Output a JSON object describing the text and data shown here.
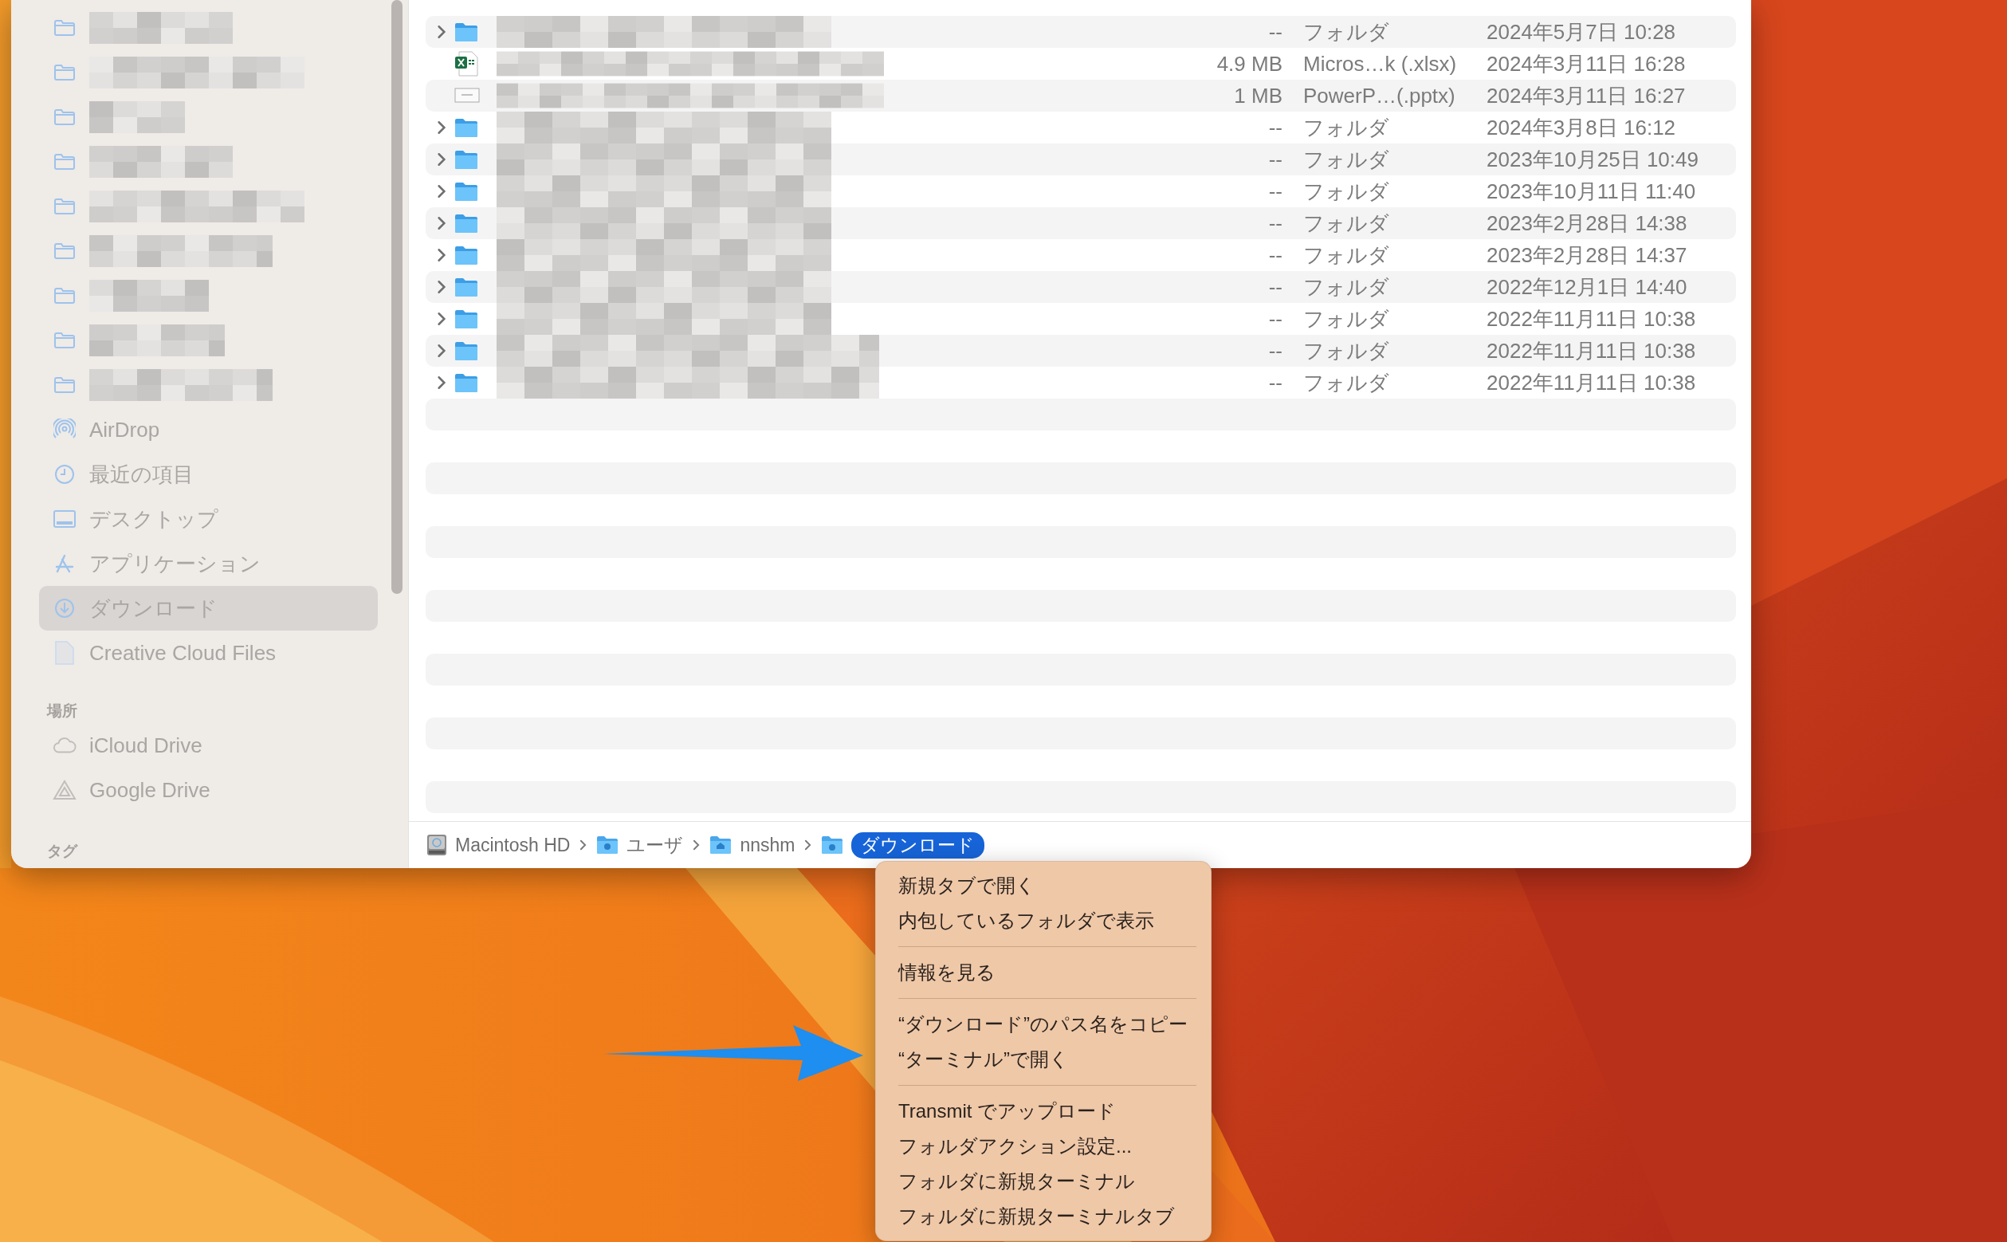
{
  "sidebar": {
    "favorites": [
      {
        "kind": "folder",
        "selected": false
      },
      {
        "kind": "folder",
        "selected": false
      },
      {
        "kind": "folder",
        "selected": false
      },
      {
        "kind": "folder",
        "selected": false
      },
      {
        "kind": "folder",
        "selected": false
      },
      {
        "kind": "folder",
        "selected": false
      },
      {
        "kind": "folder",
        "selected": false
      },
      {
        "kind": "folder",
        "selected": false
      },
      {
        "kind": "folder",
        "selected": false
      },
      {
        "kind": "airdrop",
        "label": "AirDrop",
        "selected": false
      },
      {
        "kind": "clock",
        "label": "最近の項目",
        "selected": false
      },
      {
        "kind": "desktop",
        "label": "デスクトップ",
        "selected": false
      },
      {
        "kind": "apps",
        "label": "アプリケーション",
        "selected": false
      },
      {
        "kind": "download",
        "label": "ダウンロード",
        "selected": true
      },
      {
        "kind": "document",
        "label": "Creative Cloud Files",
        "selected": false
      }
    ],
    "locations": {
      "title": "場所",
      "items": [
        {
          "kind": "cloud",
          "label": "iCloud Drive",
          "selected": false
        },
        {
          "kind": "drive",
          "label": "Google Drive",
          "selected": false
        }
      ]
    },
    "tags": {
      "title": "タグ"
    }
  },
  "file_list": {
    "rows": [
      {
        "kind": "folder",
        "size": "--",
        "type": "フォルダ",
        "modified": "2024年5月7日 10:28"
      },
      {
        "kind": "xlsx",
        "size": "4.9 MB",
        "type": "Micros…k (.xlsx)",
        "modified": "2024年3月11日 16:28"
      },
      {
        "kind": "pptx",
        "size": "1 MB",
        "type": "PowerP…(.pptx)",
        "modified": "2024年3月11日 16:27"
      },
      {
        "kind": "folder",
        "size": "--",
        "type": "フォルダ",
        "modified": "2024年3月8日 16:12"
      },
      {
        "kind": "folder",
        "size": "--",
        "type": "フォルダ",
        "modified": "2023年10月25日 10:49"
      },
      {
        "kind": "folder",
        "size": "--",
        "type": "フォルダ",
        "modified": "2023年10月11日 11:40"
      },
      {
        "kind": "folder",
        "size": "--",
        "type": "フォルダ",
        "modified": "2023年2月28日 14:38"
      },
      {
        "kind": "folder",
        "size": "--",
        "type": "フォルダ",
        "modified": "2023年2月28日 14:37"
      },
      {
        "kind": "folder",
        "size": "--",
        "type": "フォルダ",
        "modified": "2022年12月1日 14:40"
      },
      {
        "kind": "folder",
        "size": "--",
        "type": "フォルダ",
        "modified": "2022年11月11日 10:38"
      },
      {
        "kind": "folder",
        "size": "--",
        "type": "フォルダ",
        "modified": "2022年11月11日 10:38"
      },
      {
        "kind": "folder",
        "size": "--",
        "type": "フォルダ",
        "modified": "2022年11月11日 10:38"
      }
    ]
  },
  "path_bar": [
    {
      "kind": "disk",
      "label": "Macintosh HD",
      "selected": false
    },
    {
      "kind": "users",
      "label": "ユーザ",
      "selected": false
    },
    {
      "kind": "home",
      "label": "nnshm",
      "selected": false
    },
    {
      "kind": "downloads",
      "label": "ダウンロード",
      "selected": true
    }
  ],
  "context_menu": {
    "groups": [
      [
        "新規タブで開く",
        "内包しているフォルダで表示"
      ],
      [
        "情報を見る"
      ],
      [
        "“ダウンロード”のパス名をコピー",
        "“ターミナル”で開く"
      ],
      [
        "Transmit でアップロード",
        "フォルダアクション設定...",
        "フォルダに新規ターミナル",
        "フォルダに新規ターミナルタブ"
      ]
    ]
  }
}
